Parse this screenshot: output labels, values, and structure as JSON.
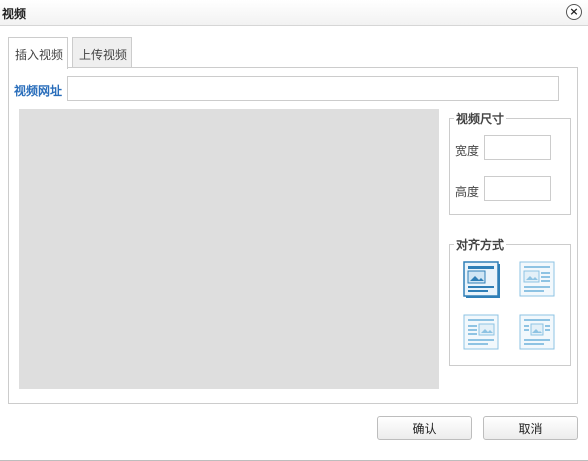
{
  "dialog": {
    "title": "视频",
    "close_icon": "close-icon"
  },
  "tabs": [
    {
      "label": "插入视频",
      "active": true
    },
    {
      "label": "上传视频",
      "active": false
    }
  ],
  "url": {
    "label": "视频网址",
    "value": ""
  },
  "size": {
    "legend": "视频尺寸",
    "width_label": "宽度",
    "width_value": "",
    "height_label": "高度",
    "height_value": ""
  },
  "alignment": {
    "legend": "对齐方式",
    "options": [
      "align-none-icon",
      "align-left-icon",
      "align-right-icon",
      "align-center-icon"
    ],
    "selected": "align-none-icon"
  },
  "buttons": {
    "ok": "确认",
    "cancel": "取消"
  },
  "colors": {
    "accent": "#2a6ebb",
    "preview_bg": "#dedede"
  }
}
